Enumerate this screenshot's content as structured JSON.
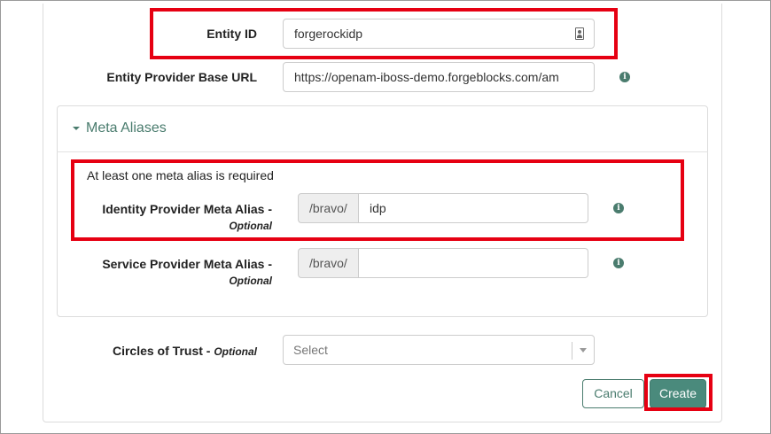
{
  "form": {
    "entity_id": {
      "label": "Entity ID",
      "value": "forgerockidp",
      "icon": "id-card-icon"
    },
    "entity_base_url": {
      "label": "Entity Provider Base URL",
      "value": "https://openam-iboss-demo.forgeblocks.com/am",
      "icon": "info-icon"
    },
    "meta_aliases": {
      "title": "Meta Aliases",
      "expanded": true,
      "hint": "At least one meta alias is required",
      "identity_provider": {
        "label": "Identity Provider Meta Alias -",
        "optional": "Optional",
        "prefix": "/bravo/",
        "value": "idp"
      },
      "service_provider": {
        "label": "Service Provider Meta Alias -",
        "optional": "Optional",
        "prefix": "/bravo/",
        "value": ""
      }
    },
    "circles_of_trust": {
      "label": "Circles of Trust -",
      "optional": "Optional",
      "placeholder": "Select"
    }
  },
  "actions": {
    "cancel_label": "Cancel",
    "create_label": "Create"
  },
  "colors": {
    "accent": "#4a7c6e",
    "highlight": "#e60012",
    "primary_button": "#4a8a7c"
  }
}
